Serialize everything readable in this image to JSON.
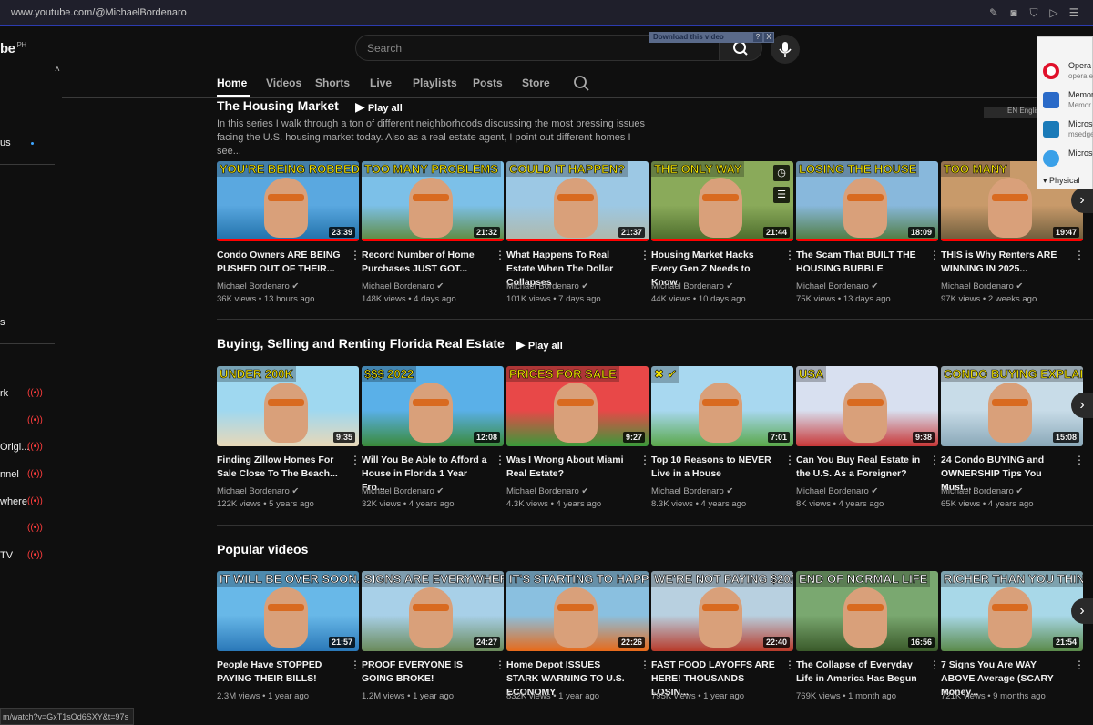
{
  "browser": {
    "url": "www.youtube.com/@MichaelBordenaro"
  },
  "sidebar": {
    "logo": "be",
    "region": "PH",
    "items": [
      "us",
      "s",
      "rk",
      "",
      "Origi...",
      "nnel",
      "where",
      "",
      "TV"
    ]
  },
  "search": {
    "placeholder": "Search"
  },
  "download_bar": {
    "label": "Download this video",
    "help": "?",
    "close": "X"
  },
  "tabs": [
    "Home",
    "Videos",
    "Shorts",
    "Live",
    "Playlists",
    "Posts",
    "Store"
  ],
  "popup": {
    "items": [
      {
        "name": "Opera I",
        "sub": "opera.e"
      },
      {
        "name": "Memor",
        "sub": "Memor"
      },
      {
        "name": "Microso",
        "sub": "msedge"
      },
      {
        "name": "Microso",
        "sub": ""
      }
    ],
    "footer": "Physical"
  },
  "lang_badge": "EN English (United",
  "sections": [
    {
      "title": "The Housing Market",
      "play_all": "Play all",
      "description": "In this series I walk through a ton of different neighborhoods discussing the most pressing issues facing the U.S. housing market today. Also as a real estate agent, I point out different homes I see...",
      "videos": [
        {
          "caption": "YOU'RE BEING ROBBED",
          "duration": "23:39",
          "title": "Condo Owners ARE BEING PUSHED OUT OF THEIR...",
          "channel": "Michael Bordenaro",
          "meta": "36K views • 13 hours ago",
          "sky": "#5aa8e0",
          "ground": "#1f6fa8"
        },
        {
          "caption": "TOO MANY PROBLEMS",
          "duration": "21:32",
          "title": "Record Number of Home Purchases JUST GOT...",
          "channel": "Michael Bordenaro",
          "meta": "148K views • 4 days ago",
          "sky": "#7cc0e8",
          "ground": "#5f8a3a"
        },
        {
          "caption": "COULD IT HAPPEN?",
          "duration": "21:37",
          "title": "What Happens To Real Estate When The Dollar Collapses",
          "channel": "Michael Bordenaro",
          "meta": "101K views • 7 days ago",
          "sky": "#9cc8e4",
          "ground": "#b0b8a8"
        },
        {
          "caption": "THE ONLY WAY",
          "duration": "21:44",
          "title": "Housing Market Hacks Every Gen Z Needs to Know",
          "channel": "Michael Bordenaro",
          "meta": "44K views • 10 days ago",
          "sky": "#8aaa5a",
          "ground": "#4a6a2a"
        },
        {
          "caption": "LOSING THE HOUSE",
          "duration": "18:09",
          "title": "The Scam That BUILT THE HOUSING BUBBLE",
          "channel": "Michael Bordenaro",
          "meta": "75K views • 13 days ago",
          "sky": "#88b8dc",
          "ground": "#4e7a3a"
        },
        {
          "caption": "TOO MANY",
          "duration": "19:47",
          "title": "THIS is Why Renters ARE WINNING IN 2025...",
          "channel": "Michael Bordenaro",
          "meta": "97K views • 2 weeks ago",
          "sky": "#c89a6a",
          "ground": "#6a5a3a"
        }
      ]
    },
    {
      "title": "Buying, Selling and Renting Florida Real Estate",
      "play_all": "Play all",
      "videos": [
        {
          "caption": "UNDER 200K",
          "duration": "9:35",
          "title": "Finding Zillow Homes For Sale Close To The Beach...",
          "channel": "Michael Bordenaro",
          "meta": "122K views • 5 years ago",
          "sky": "#9fd8f0",
          "ground": "#e8d8b8"
        },
        {
          "caption": "$$$ 2022",
          "duration": "12:08",
          "title": "Will You Be Able to Afford a House in Florida 1 Year Fro...",
          "channel": "Michael Bordenaro",
          "meta": "32K views • 4 years ago",
          "sky": "#5ab0e8",
          "ground": "#3a8a3a"
        },
        {
          "caption": "PRICES FOR SALE",
          "duration": "9:27",
          "title": "Was I Wrong About Miami Real Estate?",
          "channel": "Michael Bordenaro",
          "meta": "4.3K views • 4 years ago",
          "sky": "#e84848",
          "ground": "#3a9a3a"
        },
        {
          "caption": "✖ ✔",
          "duration": "7:01",
          "title": "Top 10 Reasons to NEVER Live in a House",
          "channel": "Michael Bordenaro",
          "meta": "8.3K views • 4 years ago",
          "sky": "#a8d8f0",
          "ground": "#5aa84a"
        },
        {
          "caption": "USA",
          "duration": "9:38",
          "title": "Can You Buy Real Estate in the U.S. As a Foreigner?",
          "channel": "Michael Bordenaro",
          "meta": "8K views • 4 years ago",
          "sky": "#d8e0f0",
          "ground": "#c83838"
        },
        {
          "caption": "CONDO BUYING EXPLAINED!",
          "duration": "15:08",
          "title": "24 Condo BUYING and OWNERSHIP Tips You Must...",
          "channel": "Michael Bordenaro",
          "meta": "65K views • 4 years ago",
          "sky": "#c8dce8",
          "ground": "#8aa8b8"
        }
      ]
    },
    {
      "title": "Popular videos",
      "videos": [
        {
          "caption": "IT WILL BE OVER SOON..",
          "duration": "21:57",
          "title": "People Have STOPPED PAYING THEIR BILLS!",
          "channel": "",
          "meta": "2.3M views • 1 year ago",
          "sky": "#68b8e8",
          "ground": "#2a78b8"
        },
        {
          "caption": "SIGNS ARE EVERYWHERE!",
          "duration": "24:27",
          "title": "PROOF EVERYONE IS GOING BROKE!",
          "channel": "",
          "meta": "1.2M views • 1 year ago",
          "sky": "#a8d0e8",
          "ground": "#6a8a5a"
        },
        {
          "caption": "IT'S STARTING TO HAPPEN..",
          "duration": "22:26",
          "title": "Home Depot ISSUES STARK WARNING TO U.S. ECONOMY",
          "channel": "",
          "meta": "832K views • 1 year ago",
          "sky": "#8ac0e0",
          "ground": "#e86a1a"
        },
        {
          "caption": "WE'RE NOT PAYING $20/HR!",
          "duration": "22:40",
          "title": "FAST FOOD LAYOFFS ARE HERE! THOUSANDS LOSIN...",
          "channel": "",
          "meta": "795K views • 1 year ago",
          "sky": "#b8d0e0",
          "ground": "#b83a2a"
        },
        {
          "caption": "END OF NORMAL LIFE",
          "duration": "16:56",
          "title": "The Collapse of Everyday Life in America Has Begun",
          "channel": "",
          "meta": "769K views • 1 month ago",
          "sky": "#7aa870",
          "ground": "#3a5a2a"
        },
        {
          "caption": "RICHER THAN YOU THINK!",
          "duration": "21:54",
          "title": "7 Signs You Are WAY ABOVE Average (SCARY Money...",
          "channel": "",
          "meta": "721K views • 9 months ago",
          "sky": "#a8d8e8",
          "ground": "#5a8a4a"
        }
      ]
    }
  ],
  "status_url": "m/watch?v=GxT1sOd6SXY&t=97s"
}
